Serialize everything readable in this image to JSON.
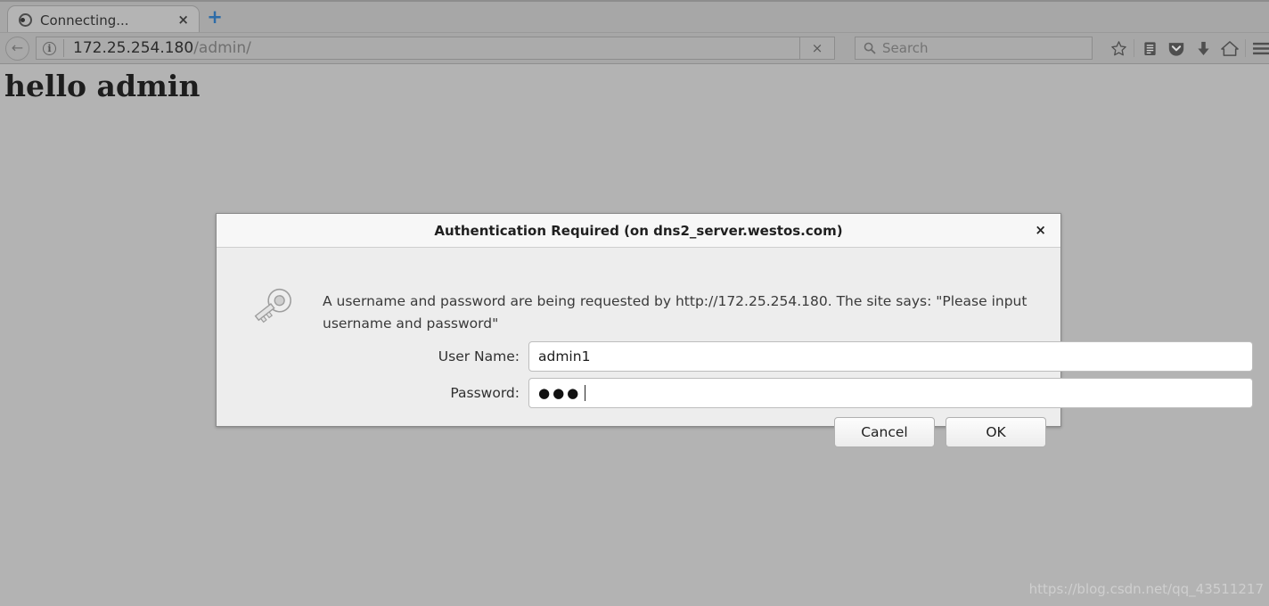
{
  "browser": {
    "tab": {
      "title": "Connecting...",
      "spinner_icon": "loading-spinner-icon",
      "close_label": "×"
    },
    "new_tab_label": "+",
    "back_label": "←",
    "info_icon_label": "ⓘ",
    "url": {
      "host": "172.25.254.180",
      "path": "/admin/"
    },
    "stop_label": "×",
    "search": {
      "placeholder": "Search",
      "icon": "search-icon"
    },
    "toolbar_icons": [
      {
        "name": "bookmark-star-icon"
      },
      {
        "name": "reader-list-icon"
      },
      {
        "name": "pocket-shield-icon"
      },
      {
        "name": "downloads-arrow-icon"
      },
      {
        "name": "home-icon"
      },
      {
        "name": "menu-hamburger-icon"
      }
    ]
  },
  "page": {
    "heading": "hello admin",
    "background_color": "#b3b3b3",
    "watermark": "https://blog.csdn.net/qq_43511217"
  },
  "dialog": {
    "title": "Authentication Required (on dns2_server.westos.com)",
    "close_label": "×",
    "icon": "key-icon",
    "message": "A username and password are being requested by http://172.25.254.180. The site says: \"Please input username and password\"",
    "fields": [
      {
        "label": "User Name:",
        "value": "admin1",
        "type": "text"
      },
      {
        "label": "Password:",
        "value": "●●●",
        "type": "password"
      }
    ],
    "buttons": {
      "cancel": "Cancel",
      "ok": "OK"
    }
  }
}
